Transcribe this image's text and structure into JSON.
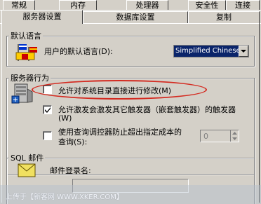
{
  "tabs_back": {
    "general": "常规",
    "memory": "内存",
    "processor": "处理器",
    "security": "安全性",
    "connections": "连接"
  },
  "tabs_front": {
    "server_settings": "服务器设置",
    "database_settings": "数据库设置",
    "replication": "复制"
  },
  "default_language": {
    "group_title": "默认语言",
    "label": "用户的默认语言(D):",
    "selected": "Simplified Chinese"
  },
  "server_behavior": {
    "group_title": "服务器行为",
    "allow_modify_catalog": {
      "label": "允许对系统目录直接进行修改(M)",
      "checked": false
    },
    "allow_nested_triggers": {
      "label_line1": "允许激发会激发其它触发器（嵌套触发器）的触发器",
      "label_line2": "(W)",
      "checked": true
    },
    "query_governor": {
      "label_line1": "使用查询调控器防止超出指定成本的",
      "label_line2": "查询(S):",
      "checked": false,
      "value": "0"
    }
  },
  "sql_mail": {
    "group_title": "SQL 邮件",
    "login_label": "邮件登录名:"
  },
  "watermark": "上传于【新客网 WWW.XKER.COM】",
  "colors": {
    "face": "#d4d0c8",
    "highlight": "#0a246a",
    "annotation": "#d42a20"
  }
}
